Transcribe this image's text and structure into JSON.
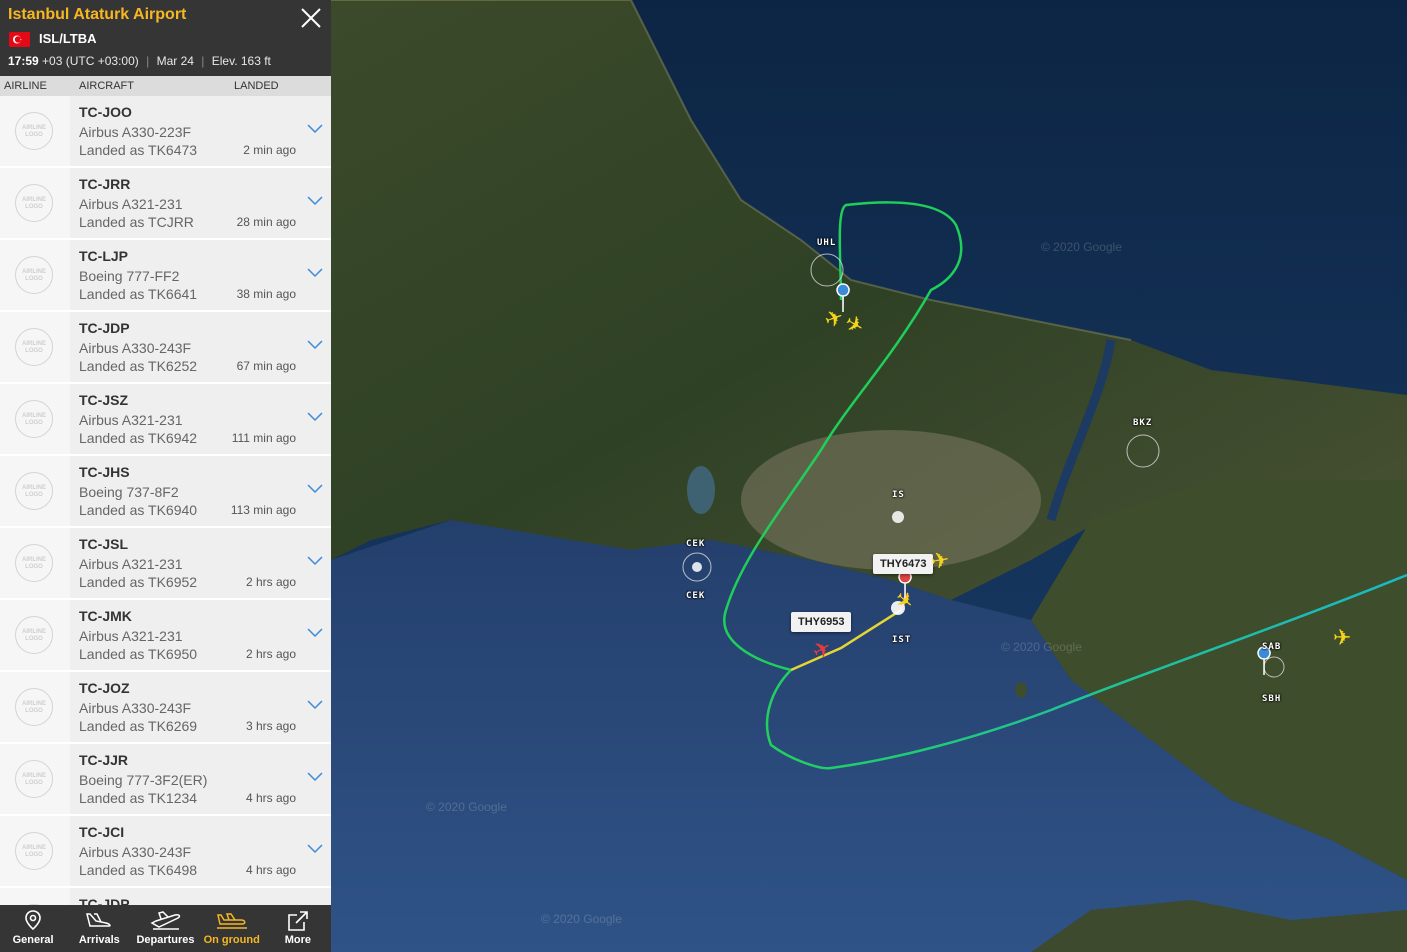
{
  "airport": {
    "name": "Istanbul Ataturk Airport",
    "code": "ISL/LTBA",
    "time": "17:59",
    "timezone": "+03 (UTC +03:00)",
    "date": "Mar 24",
    "elevation": "Elev. 163 ft"
  },
  "columns": {
    "airline": "AIRLINE",
    "aircraft": "AIRCRAFT",
    "landed": "LANDED"
  },
  "logo_placeholder": "AIRLINE LOGO",
  "rows": [
    {
      "reg": "TC-JOO",
      "type": "Airbus A330-223F",
      "landed": "Landed as TK6473",
      "ago": "2 min ago"
    },
    {
      "reg": "TC-JRR",
      "type": "Airbus A321-231",
      "landed": "Landed as TCJRR",
      "ago": "28 min ago"
    },
    {
      "reg": "TC-LJP",
      "type": "Boeing 777-FF2",
      "landed": "Landed as TK6641",
      "ago": "38 min ago"
    },
    {
      "reg": "TC-JDP",
      "type": "Airbus A330-243F",
      "landed": "Landed as TK6252",
      "ago": "67 min ago"
    },
    {
      "reg": "TC-JSZ",
      "type": "Airbus A321-231",
      "landed": "Landed as TK6942",
      "ago": "111 min ago"
    },
    {
      "reg": "TC-JHS",
      "type": "Boeing 737-8F2",
      "landed": "Landed as TK6940",
      "ago": "113 min ago"
    },
    {
      "reg": "TC-JSL",
      "type": "Airbus A321-231",
      "landed": "Landed as TK6952",
      "ago": "2 hrs ago"
    },
    {
      "reg": "TC-JMK",
      "type": "Airbus A321-231",
      "landed": "Landed as TK6950",
      "ago": "2 hrs ago"
    },
    {
      "reg": "TC-JOZ",
      "type": "Airbus A330-243F",
      "landed": "Landed as TK6269",
      "ago": "3 hrs ago"
    },
    {
      "reg": "TC-JJR",
      "type": "Boeing 777-3F2(ER)",
      "landed": "Landed as TK1234",
      "ago": "4 hrs ago"
    },
    {
      "reg": "TC-JCI",
      "type": "Airbus A330-243F",
      "landed": "Landed as TK6498",
      "ago": "4 hrs ago"
    },
    {
      "reg": "TC-JDP",
      "type": "",
      "landed": "",
      "ago": ""
    }
  ],
  "nav": [
    {
      "label": "General",
      "icon": "pin-icon"
    },
    {
      "label": "Arrivals",
      "icon": "arrival-plane-icon"
    },
    {
      "label": "Departures",
      "icon": "departure-plane-icon"
    },
    {
      "label": "On ground",
      "icon": "ground-plane-icon",
      "active": true
    },
    {
      "label": "More",
      "icon": "share-icon"
    }
  ],
  "map": {
    "airport_labels": [
      "UHL",
      "BKZ",
      "IS",
      "CEK",
      "CEK",
      "IST",
      "SAB",
      "SBH"
    ],
    "callsigns": [
      "THY6473",
      "THY6953"
    ],
    "watermark": "© 2020 Google"
  },
  "colors": {
    "accent": "#f6b723",
    "panel_dark": "#353535",
    "track_green": "#1fcf5a",
    "track_cyan": "#1bb8c4",
    "plane_yellow": "#f7d21b",
    "plane_red": "#e83b3b"
  }
}
